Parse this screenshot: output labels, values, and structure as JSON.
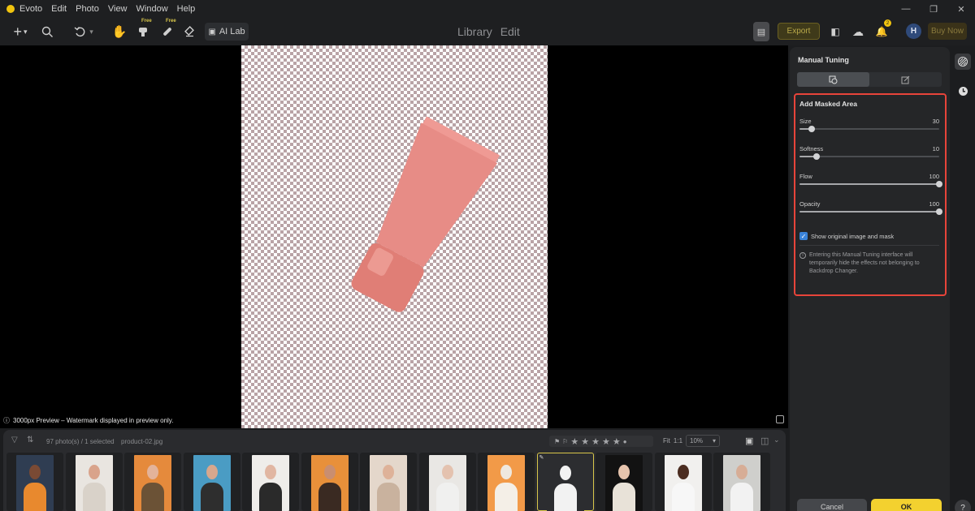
{
  "menubar": {
    "app_name": "Evoto",
    "items": [
      "Edit",
      "Photo",
      "View",
      "Window",
      "Help"
    ]
  },
  "toolbar": {
    "free_label_1": "Free",
    "free_label_2": "Free",
    "ai_lab_label": "AI Lab",
    "mode_library": "Library",
    "mode_edit": "Edit",
    "export_label": "Export",
    "notification_count": "2",
    "avatar_initial": "H",
    "buy_now_label": "Buy Now"
  },
  "canvas": {
    "preview_note": "3000px Preview – Watermark displayed in preview only."
  },
  "panel": {
    "title": "Manual Tuning",
    "section_title": "Add Masked Area",
    "sliders": [
      {
        "label": "Size",
        "value": "30",
        "fraction": 0.09
      },
      {
        "label": "Softness",
        "value": "10",
        "fraction": 0.12
      },
      {
        "label": "Flow",
        "value": "100",
        "fraction": 1.0
      },
      {
        "label": "Opacity",
        "value": "100",
        "fraction": 1.0
      }
    ],
    "show_original_label": "Show original image and mask",
    "show_original_checked": true,
    "info_text": "Entering this Manual Tuning interface will temporarily hide the effects not belonging to Backdrop Changer.",
    "cancel_label": "Cancel",
    "ok_label": "OK"
  },
  "filmstrip": {
    "count_text": "97 photo(s) / 1 selected",
    "filename": "product-02.jpg",
    "fit_label": "Fit",
    "one_to_one_label": "1:1",
    "zoom_value": "10%",
    "stars": [
      "★",
      "★",
      "★",
      "★",
      "★"
    ],
    "thumbnails": [
      {
        "bg": "#2f3d52",
        "figure": "#e8892e",
        "skin": "#7a4a34"
      },
      {
        "bg": "#e9e5e0",
        "figure": "#d9d2c9",
        "skin": "#d9a38b"
      },
      {
        "bg": "#e58a3c",
        "figure": "#6b5236",
        "skin": "#e3b39a"
      },
      {
        "bg": "#4a9cc4",
        "figure": "#2e2e2e",
        "skin": "#d7a78d"
      },
      {
        "bg": "#efedea",
        "figure": "#2a2a2a",
        "skin": "#e1b6a2"
      },
      {
        "bg": "#e8903a",
        "figure": "#3a2a22",
        "skin": "#c98e70"
      },
      {
        "bg": "#e4d7cb",
        "figure": "#c9b29e",
        "skin": "#deb299"
      },
      {
        "bg": "#e9e7e4",
        "figure": "#f0f0ef",
        "skin": "#e4c2af"
      },
      {
        "bg": "#f29a48",
        "figure": "#f4efe7",
        "skin": "#efe8de"
      },
      {
        "bg": "#2c2d30",
        "figure": "#f2f2f2",
        "skin": "#f2f2f2"
      },
      {
        "bg": "#121212",
        "figure": "#e8e2d8",
        "skin": "#e6c4ad"
      },
      {
        "bg": "#f1f0ee",
        "figure": "#f7f7f7",
        "skin": "#4b2c20"
      },
      {
        "bg": "#cfcfcc",
        "figure": "#f2f2f2",
        "skin": "#d7ad96"
      }
    ]
  },
  "colors": {
    "accent_yellow": "#f3d12f",
    "highlight_red": "#e8443a",
    "checkbox_blue": "#3a83d9",
    "product_pink": "#e78c86"
  }
}
